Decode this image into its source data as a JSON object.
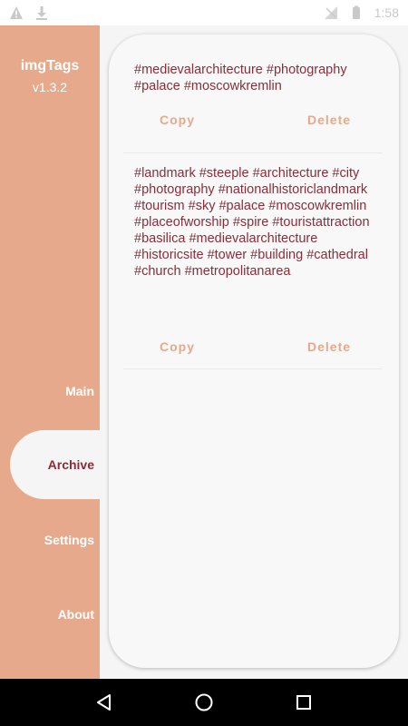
{
  "status_bar": {
    "time": "1:58",
    "icons": [
      "warning-icon",
      "download-icon",
      "signal-icon",
      "battery-icon"
    ]
  },
  "sidebar": {
    "app_title": "imgTags",
    "app_version": "v1.3.2",
    "items": [
      {
        "label": "Main"
      },
      {
        "label": "Archive"
      },
      {
        "label": "Settings"
      },
      {
        "label": "About"
      }
    ],
    "active": "Archive"
  },
  "archive": {
    "entries": [
      {
        "tags": "#medievalarchitecture #photography #palace #moscowkremlin",
        "copy_label": "Copy",
        "delete_label": "Delete"
      },
      {
        "tags": "#landmark #steeple #architecture #city #photography #nationalhistoriclandmark #tourism #sky #palace #moscowkremlin #placeofworship #spire #touristattraction #basilica #medievalarchitecture #historicsite #tower #building #cathedral #church #metropolitanarea",
        "copy_label": "Copy",
        "delete_label": "Delete"
      }
    ]
  },
  "navigation_bar": {
    "buttons": [
      "back-icon",
      "home-icon",
      "recents-icon"
    ]
  },
  "colors": {
    "accent": "#e6a98b",
    "tag_text": "#8a2d3a",
    "panel_bg": "#f8f8f8"
  }
}
